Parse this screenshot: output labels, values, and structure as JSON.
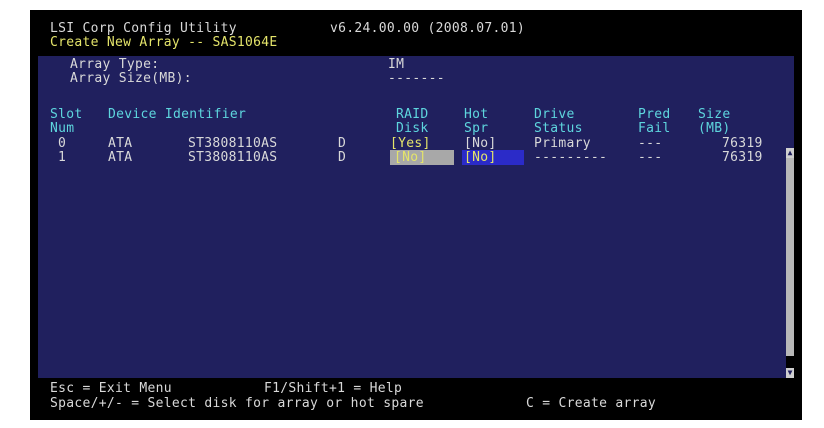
{
  "header": {
    "app_title": "LSI Corp Config Utility",
    "version": "v6.24.00.00 (2008.07.01)",
    "subtitle": "Create New Array -- SAS1064E"
  },
  "array_info": {
    "type_label": "Array Type:",
    "type_value": "IM",
    "size_label": "Array Size(MB):",
    "size_value": "-------"
  },
  "columns": {
    "slot_1": "Slot",
    "slot_2": "Num",
    "device": "Device Identifier",
    "raid_1": "RAID",
    "raid_2": "Disk",
    "hot_1": "Hot",
    "hot_2": "Spr",
    "status_1": "Drive",
    "status_2": "Status",
    "pred_1": "Pred",
    "pred_2": "Fail",
    "size_1": "Size",
    "size_2": "(MB)"
  },
  "rows": [
    {
      "slot": "0",
      "vendor": "ATA",
      "model": "ST3808110AS",
      "rev": "D",
      "raid": "[Yes]",
      "hot": "[No]",
      "status": "Primary",
      "pred": "---",
      "size": "76319"
    },
    {
      "slot": "1",
      "vendor": "ATA",
      "model": "ST3808110AS",
      "rev": "D",
      "raid": "[No]",
      "hot": "[No]",
      "status": "---------",
      "pred": "---",
      "size": "76319"
    }
  ],
  "footer": {
    "esc": "Esc = Exit Menu",
    "f1": "F1/Shift+1 = Help",
    "space": "Space/+/- = Select disk for array or hot spare",
    "create": "C = Create array"
  },
  "colors": {
    "background": "#20205e",
    "title_text": "#d9d9d9",
    "header_cyan": "#5ed6de",
    "highlight_yellow": "#e4e46a",
    "cursor_grey": "#a8a8a8",
    "cursor_blue": "#2b2bc8"
  },
  "icons": {
    "scroll_up": "▲",
    "scroll_down": "▼"
  }
}
